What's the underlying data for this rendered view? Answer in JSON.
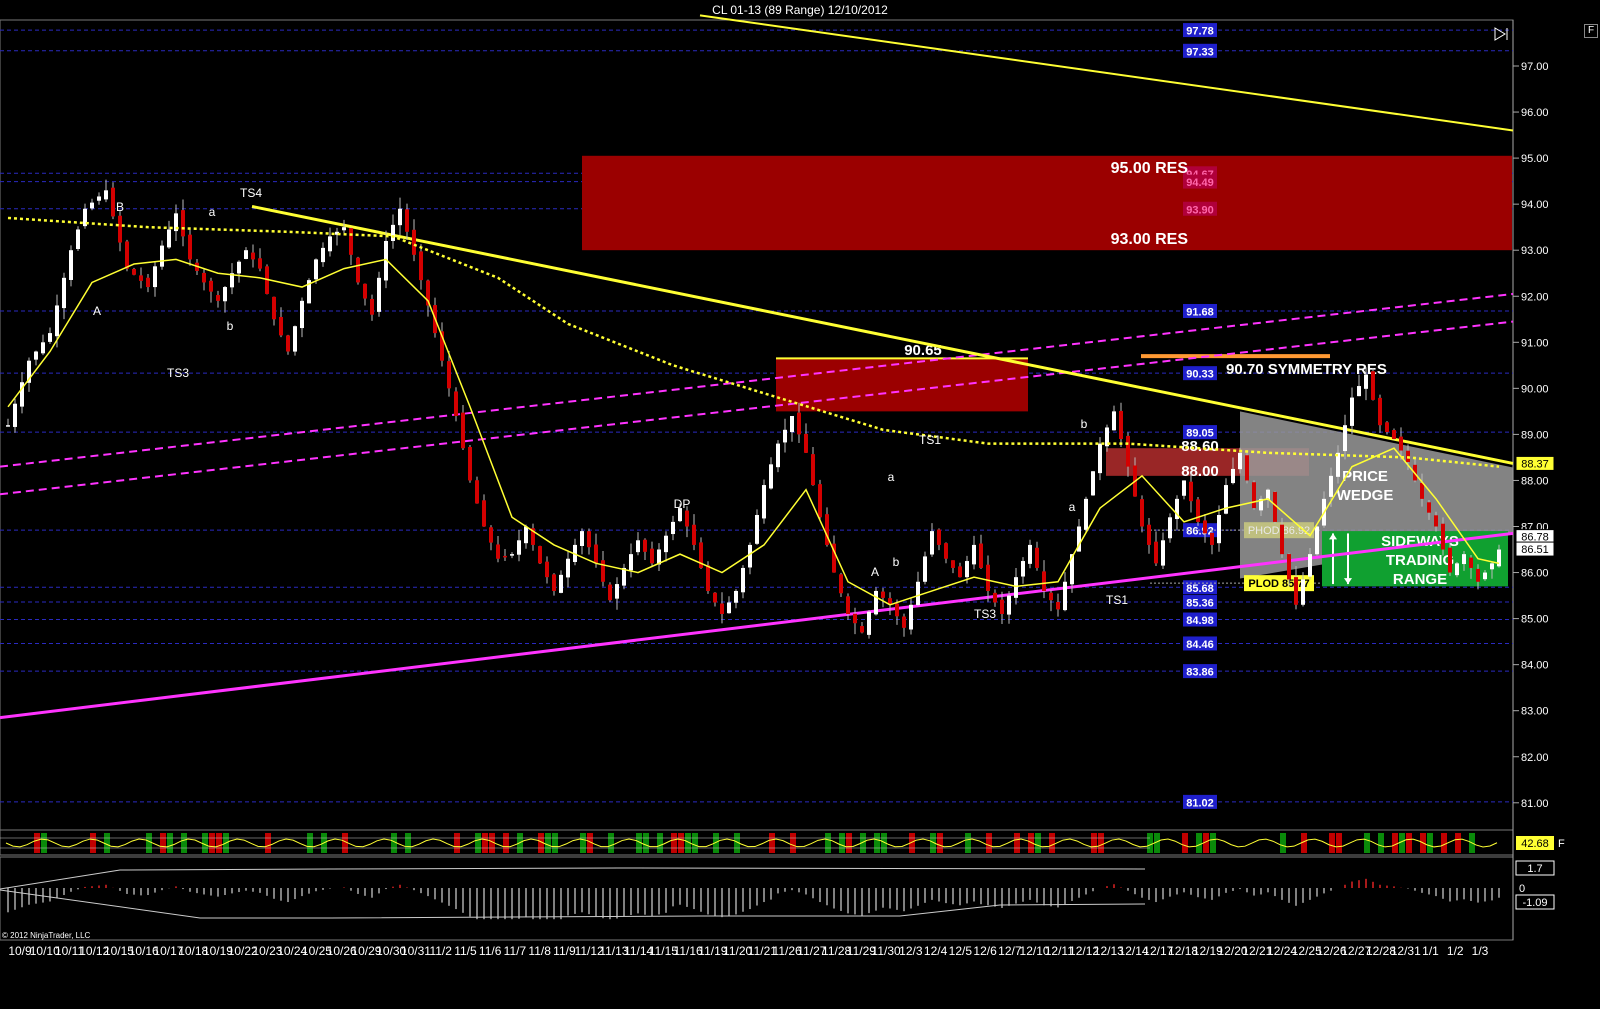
{
  "window_title": "CL 01-13 (89 Range)  12/10/2012",
  "copyright": "© 2012 NinjaTrader, LLC",
  "f_button": "F",
  "colors": {
    "background": "#000000",
    "candle_up": "#ffffff",
    "candle_down": "#d40000",
    "trendline": "#ffff33",
    "channel": "#ff33ff",
    "sma_slow": "#ffff33",
    "level_line": "#2a2ac0",
    "res_zone": "#9b0000",
    "wedge": "#9a9a9a",
    "range_box": "#10a030"
  },
  "chart_data": {
    "type": "candlestick",
    "title": "CL 01-13 (89 Range)  12/10/2012",
    "y_axis": {
      "range": [
        80.7,
        98.0
      ],
      "ticks": [
        "97.00",
        "96.00",
        "95.00",
        "94.00",
        "93.00",
        "92.00",
        "91.00",
        "90.00",
        "89.00",
        "88.00",
        "87.00",
        "86.00",
        "85.00",
        "84.00",
        "83.00",
        "82.00",
        "81.00"
      ]
    },
    "x_tick_labels": [
      "10/9",
      "10/10",
      "10/11",
      "10/12",
      "10/15",
      "10/16",
      "10/17",
      "10/18",
      "10/19",
      "10/22",
      "10/23",
      "10/24",
      "10/25",
      "10/26",
      "10/29",
      "10/30",
      "10/31",
      "11/2",
      "11/5",
      "11/6",
      "11/7",
      "11/8",
      "11/9",
      "11/12",
      "11/13",
      "11/14",
      "11/15",
      "11/16",
      "11/19",
      "11/20",
      "11/21",
      "11/26",
      "11/27",
      "11/28",
      "11/29",
      "11/30",
      "12/3",
      "12/4",
      "12/5",
      "12/6",
      "12/7",
      "12/10",
      "12/11",
      "12/12",
      "12/13",
      "12/14",
      "12/17",
      "12/18",
      "12/19",
      "12/20",
      "12/21",
      "12/24",
      "12/25",
      "12/26",
      "12/27",
      "12/28",
      "12/31",
      "1/1",
      "1/2",
      "1/3"
    ],
    "price_path": [
      [
        0,
        89.2
      ],
      [
        3,
        90.6
      ],
      [
        6,
        91.2
      ],
      [
        9,
        93.0
      ],
      [
        11,
        93.9
      ],
      [
        14,
        94.3
      ],
      [
        17,
        92.6
      ],
      [
        20,
        92.2
      ],
      [
        22,
        93.1
      ],
      [
        24,
        93.8
      ],
      [
        26,
        92.8
      ],
      [
        28,
        92.3
      ],
      [
        30,
        91.9
      ],
      [
        32,
        92.5
      ],
      [
        34,
        93.0
      ],
      [
        36,
        92.6
      ],
      [
        38,
        91.5
      ],
      [
        40,
        90.8
      ],
      [
        42,
        91.9
      ],
      [
        44,
        92.8
      ],
      [
        46,
        93.3
      ],
      [
        48,
        93.5
      ],
      [
        50,
        92.3
      ],
      [
        52,
        91.6
      ],
      [
        54,
        93.2
      ],
      [
        56,
        93.9
      ],
      [
        58,
        92.9
      ],
      [
        60,
        91.8
      ],
      [
        62,
        90.6
      ],
      [
        64,
        89.4
      ],
      [
        66,
        88.0
      ],
      [
        68,
        87.0
      ],
      [
        70,
        86.3
      ],
      [
        72,
        86.4
      ],
      [
        74,
        87.0
      ],
      [
        76,
        86.2
      ],
      [
        78,
        85.6
      ],
      [
        80,
        86.3
      ],
      [
        82,
        86.9
      ],
      [
        84,
        86.2
      ],
      [
        86,
        85.4
      ],
      [
        88,
        86.1
      ],
      [
        90,
        86.7
      ],
      [
        92,
        86.2
      ],
      [
        94,
        86.8
      ],
      [
        96,
        87.4
      ],
      [
        98,
        86.6
      ],
      [
        100,
        85.6
      ],
      [
        102,
        85.1
      ],
      [
        104,
        85.6
      ],
      [
        106,
        86.6
      ],
      [
        108,
        87.9
      ],
      [
        110,
        88.8
      ],
      [
        112,
        89.4
      ],
      [
        114,
        88.6
      ],
      [
        116,
        87.2
      ],
      [
        118,
        86.0
      ],
      [
        120,
        85.1
      ],
      [
        122,
        84.7
      ],
      [
        124,
        85.6
      ],
      [
        126,
        85.3
      ],
      [
        128,
        84.8
      ],
      [
        130,
        85.8
      ],
      [
        132,
        86.9
      ],
      [
        134,
        86.3
      ],
      [
        136,
        85.9
      ],
      [
        138,
        86.6
      ],
      [
        140,
        85.6
      ],
      [
        142,
        85.1
      ],
      [
        144,
        85.9
      ],
      [
        146,
        86.6
      ],
      [
        148,
        85.6
      ],
      [
        150,
        85.2
      ],
      [
        152,
        86.4
      ],
      [
        154,
        87.6
      ],
      [
        156,
        88.8
      ],
      [
        158,
        89.5
      ],
      [
        160,
        88.3
      ],
      [
        162,
        87.0
      ],
      [
        164,
        86.2
      ],
      [
        166,
        87.2
      ],
      [
        168,
        88.0
      ],
      [
        170,
        87.1
      ],
      [
        172,
        86.6
      ],
      [
        174,
        87.9
      ],
      [
        176,
        88.6
      ],
      [
        178,
        87.4
      ],
      [
        180,
        87.8
      ],
      [
        182,
        86.4
      ],
      [
        184,
        85.3
      ],
      [
        186,
        86.4
      ],
      [
        188,
        87.6
      ],
      [
        190,
        88.6
      ],
      [
        192,
        89.8
      ],
      [
        194,
        90.3
      ],
      [
        196,
        89.2
      ],
      [
        198,
        88.9
      ],
      [
        200,
        88.4
      ],
      [
        202,
        87.6
      ],
      [
        204,
        87.0
      ],
      [
        206,
        86.0
      ],
      [
        208,
        86.4
      ],
      [
        210,
        85.8
      ],
      [
        212,
        86.2
      ],
      [
        213,
        86.5
      ]
    ],
    "sma_fast": [
      [
        0,
        89.6
      ],
      [
        6,
        90.8
      ],
      [
        12,
        92.3
      ],
      [
        18,
        92.7
      ],
      [
        24,
        92.8
      ],
      [
        30,
        92.5
      ],
      [
        36,
        92.4
      ],
      [
        42,
        92.2
      ],
      [
        48,
        92.6
      ],
      [
        54,
        92.8
      ],
      [
        60,
        91.9
      ],
      [
        66,
        89.6
      ],
      [
        72,
        87.2
      ],
      [
        78,
        86.6
      ],
      [
        84,
        86.2
      ],
      [
        90,
        86.0
      ],
      [
        96,
        86.4
      ],
      [
        102,
        86.0
      ],
      [
        108,
        86.6
      ],
      [
        114,
        87.8
      ],
      [
        120,
        85.8
      ],
      [
        126,
        85.3
      ],
      [
        132,
        85.6
      ],
      [
        138,
        85.9
      ],
      [
        144,
        85.7
      ],
      [
        150,
        85.8
      ],
      [
        156,
        87.4
      ],
      [
        162,
        88.1
      ],
      [
        168,
        87.1
      ],
      [
        174,
        87.4
      ],
      [
        180,
        87.6
      ],
      [
        186,
        86.8
      ],
      [
        192,
        88.3
      ],
      [
        198,
        88.7
      ],
      [
        204,
        87.6
      ],
      [
        210,
        86.3
      ],
      [
        213,
        86.2
      ]
    ],
    "sma_slow": [
      [
        0,
        93.7
      ],
      [
        20,
        93.5
      ],
      [
        40,
        93.4
      ],
      [
        55,
        93.3
      ],
      [
        70,
        92.4
      ],
      [
        80,
        91.4
      ],
      [
        95,
        90.5
      ],
      [
        110,
        89.8
      ],
      [
        125,
        89.1
      ],
      [
        140,
        88.8
      ],
      [
        160,
        88.8
      ],
      [
        180,
        88.6
      ],
      [
        200,
        88.5
      ],
      [
        213,
        88.3
      ]
    ],
    "horizontal_levels": [
      "97.78",
      "97.33",
      "94.67",
      "94.49",
      "93.90",
      "91.68",
      "90.33",
      "89.05",
      "86.92",
      "85.68",
      "85.36",
      "84.98",
      "84.46",
      "83.86",
      "81.02"
    ],
    "level_badges": [
      "97.78",
      "97.33",
      "91.68",
      "90.33",
      "89.05",
      "86.92",
      "85.68",
      "85.36",
      "84.98",
      "84.46",
      "83.86",
      "81.02"
    ],
    "resistance_badges": [
      "94.67",
      "94.49",
      "93.90"
    ],
    "right_axis_badges": [
      {
        "text": "88.37",
        "color": "#ffff33"
      },
      {
        "text": "86.78",
        "color": "#ffffff"
      },
      {
        "text": "86.51",
        "color": "#ffffff"
      }
    ],
    "swing_labels": [
      "B",
      "a",
      "A",
      "TS3",
      "b",
      "TS4",
      "DP",
      "TS1",
      "a",
      "A",
      "b",
      "TS3",
      "b",
      "a",
      "TS1"
    ],
    "annotations": {
      "res_95": "95.00 RES",
      "res_93": "93.00 RES",
      "level_9065": "90.65",
      "symmetry": "90.70 SYMMETRY RES",
      "level_8860": "88.60",
      "level_8800": "88.00",
      "wedge_title": "PRICE WEDGE",
      "range_title": "SIDEWAYS TRADING RANGE",
      "phod": "PHOD 86.92",
      "plod": "PLOD 85.77"
    },
    "oscillator": {
      "value_badge": "42.68"
    },
    "macd": {
      "range": [
        -1.09,
        1.7
      ],
      "badges": [
        "1.7",
        "0",
        "-1.09"
      ]
    }
  }
}
